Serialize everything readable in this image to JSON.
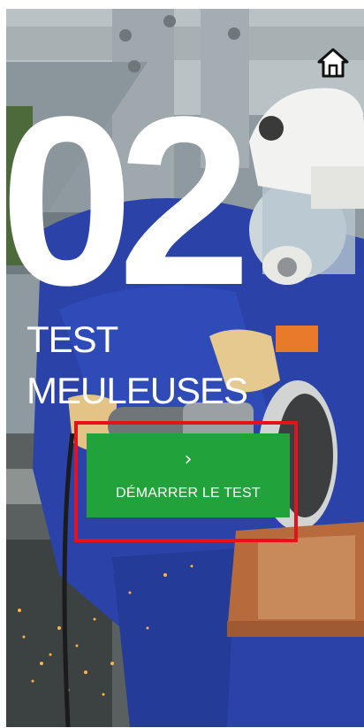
{
  "intro": {
    "test_number": "02",
    "title_line1": "TEST",
    "title_line2": "MEULEUSES",
    "start_button_label": "DÉMARRER LE TEST",
    "start_button_chevron": "›"
  },
  "icons": {
    "home": "home-icon",
    "chevron": "chevron-right-icon"
  },
  "colors": {
    "accent_green": "#22a23a",
    "highlight_red": "#e8101a",
    "workwear_blue": "#2b43a8"
  }
}
